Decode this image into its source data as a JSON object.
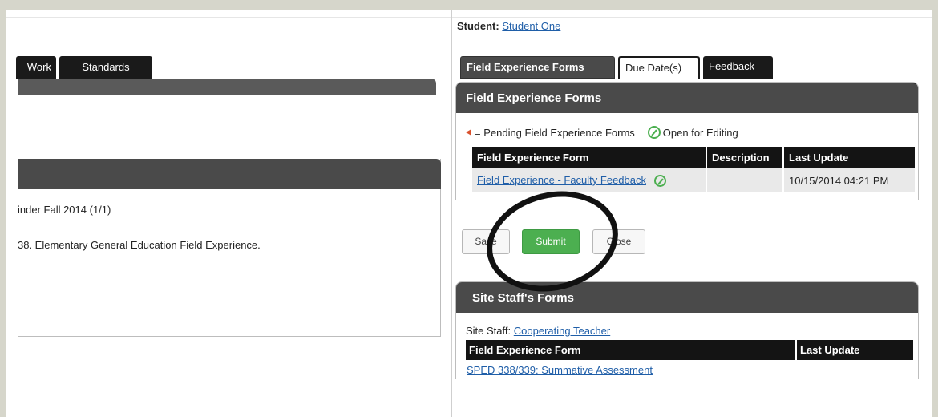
{
  "left": {
    "tabs": [
      {
        "label": "Work"
      },
      {
        "label": "Standards"
      }
    ],
    "lines": [
      "inder Fall 2014 (1/1)",
      "38. Elementary General Education Field Experience."
    ]
  },
  "student": {
    "label": "Student:",
    "name": "Student One"
  },
  "tabs": [
    {
      "label": "Field Experience Forms"
    },
    {
      "label": "Due Date(s)"
    },
    {
      "label": "Feedback"
    }
  ],
  "forms_panel": {
    "title": "Field Experience Forms",
    "legend_pending": "= Pending Field Experience Forms",
    "legend_open": "Open for Editing",
    "columns": [
      "Field Experience Form",
      "Description",
      "Last Update"
    ],
    "rows": [
      {
        "form": "Field Experience - Faculty Feedback",
        "description": "",
        "last_update": "10/15/2014 04:21 PM"
      }
    ]
  },
  "buttons": {
    "save": "Save",
    "submit": "Submit",
    "close": "Close"
  },
  "site_panel": {
    "title": "Site Staff's Forms",
    "staff_label": "Site Staff:",
    "staff_name": "Cooperating Teacher",
    "columns": [
      "Field Experience Form",
      "Last Update"
    ],
    "rows": [
      {
        "form": "SPED 338/339: Summative Assessment",
        "last_update": ""
      }
    ]
  },
  "colors": {
    "accent_green": "#4caf50",
    "header_dark": "#4a4a4a",
    "link_blue": "#1f5ea8",
    "pending_flag": "#d9502c"
  }
}
